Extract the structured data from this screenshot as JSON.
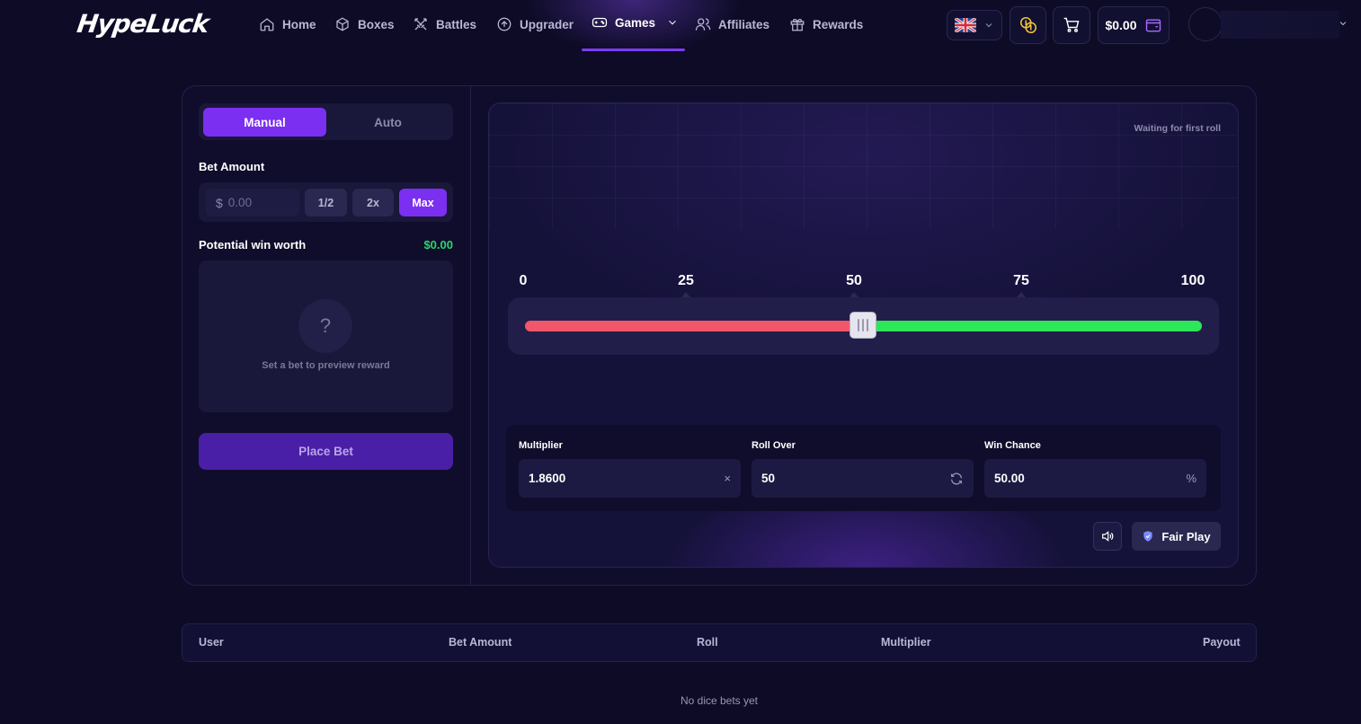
{
  "nav": {
    "logo": "HypeLuck",
    "links": [
      {
        "label": "Home",
        "icon": "home-icon"
      },
      {
        "label": "Boxes",
        "icon": "box-icon"
      },
      {
        "label": "Battles",
        "icon": "swords-icon"
      },
      {
        "label": "Upgrader",
        "icon": "arrow-up-circle-icon"
      },
      {
        "label": "Games",
        "icon": "gamepad-icon",
        "active": true
      },
      {
        "label": "Affiliates",
        "icon": "users-icon"
      },
      {
        "label": "Rewards",
        "icon": "gift-icon"
      }
    ],
    "balance": "$0.00"
  },
  "left_panel": {
    "tabs": {
      "manual": "Manual",
      "auto": "Auto"
    },
    "bet_amount_label": "Bet Amount",
    "currency_symbol": "$",
    "bet_placeholder": "0.00",
    "half_label": "1/2",
    "double_label": "2x",
    "max_label": "Max",
    "potential_win_label": "Potential win worth",
    "potential_win_value": "$0.00",
    "preview_question": "?",
    "preview_text": "Set a bet to preview reward",
    "place_bet_label": "Place Bet"
  },
  "dice": {
    "status": "Waiting for first roll",
    "ticks": [
      "0",
      "25",
      "50",
      "75",
      "100"
    ],
    "slider_value": 50,
    "multiplier_label": "Multiplier",
    "multiplier_value": "1.8600",
    "multiplier_suffix": "×",
    "roll_over_label": "Roll Over",
    "roll_over_value": "50",
    "win_chance_label": "Win Chance",
    "win_chance_value": "50.00",
    "win_chance_suffix": "%",
    "fair_play_label": "Fair Play",
    "colors": {
      "lose": "#f2566a",
      "win": "#2ee65a",
      "accent": "#7b2ff0"
    }
  },
  "bets_table": {
    "columns": [
      "User",
      "Bet Amount",
      "Roll",
      "Multiplier",
      "Payout"
    ],
    "empty_text": "No dice bets yet"
  }
}
